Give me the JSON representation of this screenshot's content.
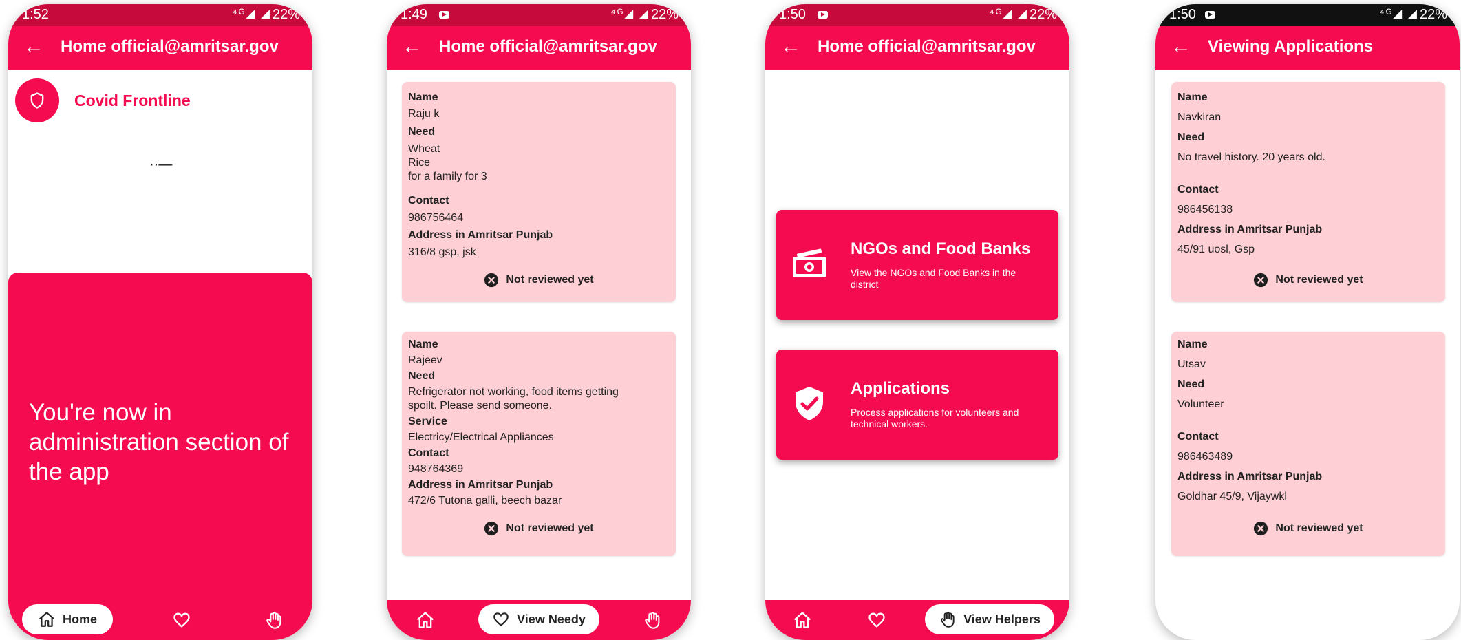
{
  "phone1": {
    "status": {
      "time": "1:52",
      "signal": "⁴ᴳ◢ ◢",
      "battery": "22%"
    },
    "appbar": {
      "back": "←",
      "title": "Home official@amritsar.gov"
    },
    "brand": {
      "name": "Covid Frontline",
      "icon": "shield-icon"
    },
    "loader": "··—",
    "banner": {
      "text": "You're now in administration section of the app"
    },
    "nav": {
      "active_label": "Home",
      "items": [
        "home-icon",
        "heart-icon",
        "hand-icon"
      ]
    }
  },
  "phone2": {
    "status": {
      "time": "1:49",
      "signal": "⁴ᴳ◢ ◢",
      "battery": "22%"
    },
    "appbar": {
      "back": "←",
      "title": "Home official@amritsar.gov"
    },
    "labels": {
      "name": "Name",
      "need": "Need",
      "service": "Service",
      "contact": "Contact",
      "address": "Address in Amritsar Punjab"
    },
    "cards": [
      {
        "name": "Raju k",
        "need": [
          "Wheat",
          "Rice",
          "for a family for 3"
        ],
        "contact": "986756464",
        "address": "316/8 gsp, jsk",
        "status": "Not reviewed yet"
      },
      {
        "name": "Rajeev",
        "need": [
          "Refrigerator not working, food items getting",
          "spoilt. Please send someone."
        ],
        "service": "Electricy/Electrical Appliances",
        "contact": "948764369",
        "address": "472/6 Tutona galli, beech bazar",
        "status": "Not reviewed yet"
      }
    ],
    "nav": {
      "active_label": "View Needy",
      "items": [
        "home-icon",
        "heart-icon",
        "hand-icon"
      ]
    }
  },
  "phone3": {
    "status": {
      "time": "1:50",
      "signal": "⁴ᴳ◢ ◢",
      "battery": "22%"
    },
    "appbar": {
      "back": "←",
      "title": "Home official@amritsar.gov"
    },
    "menu": [
      {
        "title": "NGOs and Food Banks",
        "subtitle": "View the NGOs and Food Banks in the district",
        "icon": "money-icon"
      },
      {
        "title": "Applications",
        "subtitle": "Process applications for volunteers and technical workers.",
        "icon": "shield-check-icon"
      }
    ],
    "nav": {
      "active_label": "View Helpers",
      "items": [
        "home-icon",
        "heart-icon",
        "hand-icon"
      ]
    }
  },
  "phone4": {
    "status": {
      "time": "1:50",
      "signal": "⁴ᴳ◢ ◢",
      "battery": "22%"
    },
    "appbar": {
      "back": "←",
      "title": "Viewing Applications"
    },
    "labels": {
      "name": "Name",
      "need": "Need",
      "contact": "Contact",
      "address": "Address in Amritsar Punjab"
    },
    "cards": [
      {
        "name": "Navkiran",
        "need": "No travel history. 20 years old.",
        "contact": "986456138",
        "address": "45/91 uosl, Gsp",
        "status": "Not reviewed yet"
      },
      {
        "name": "Utsav",
        "need": "Volunteer",
        "contact": "986463489",
        "address": "Goldhar 45/9, Vijaywkl",
        "status": "Not reviewed yet"
      }
    ]
  },
  "colors": {
    "primary": "#f50b4f",
    "status_bar": "#c70a3c",
    "card_bg": "#fecfd4"
  }
}
